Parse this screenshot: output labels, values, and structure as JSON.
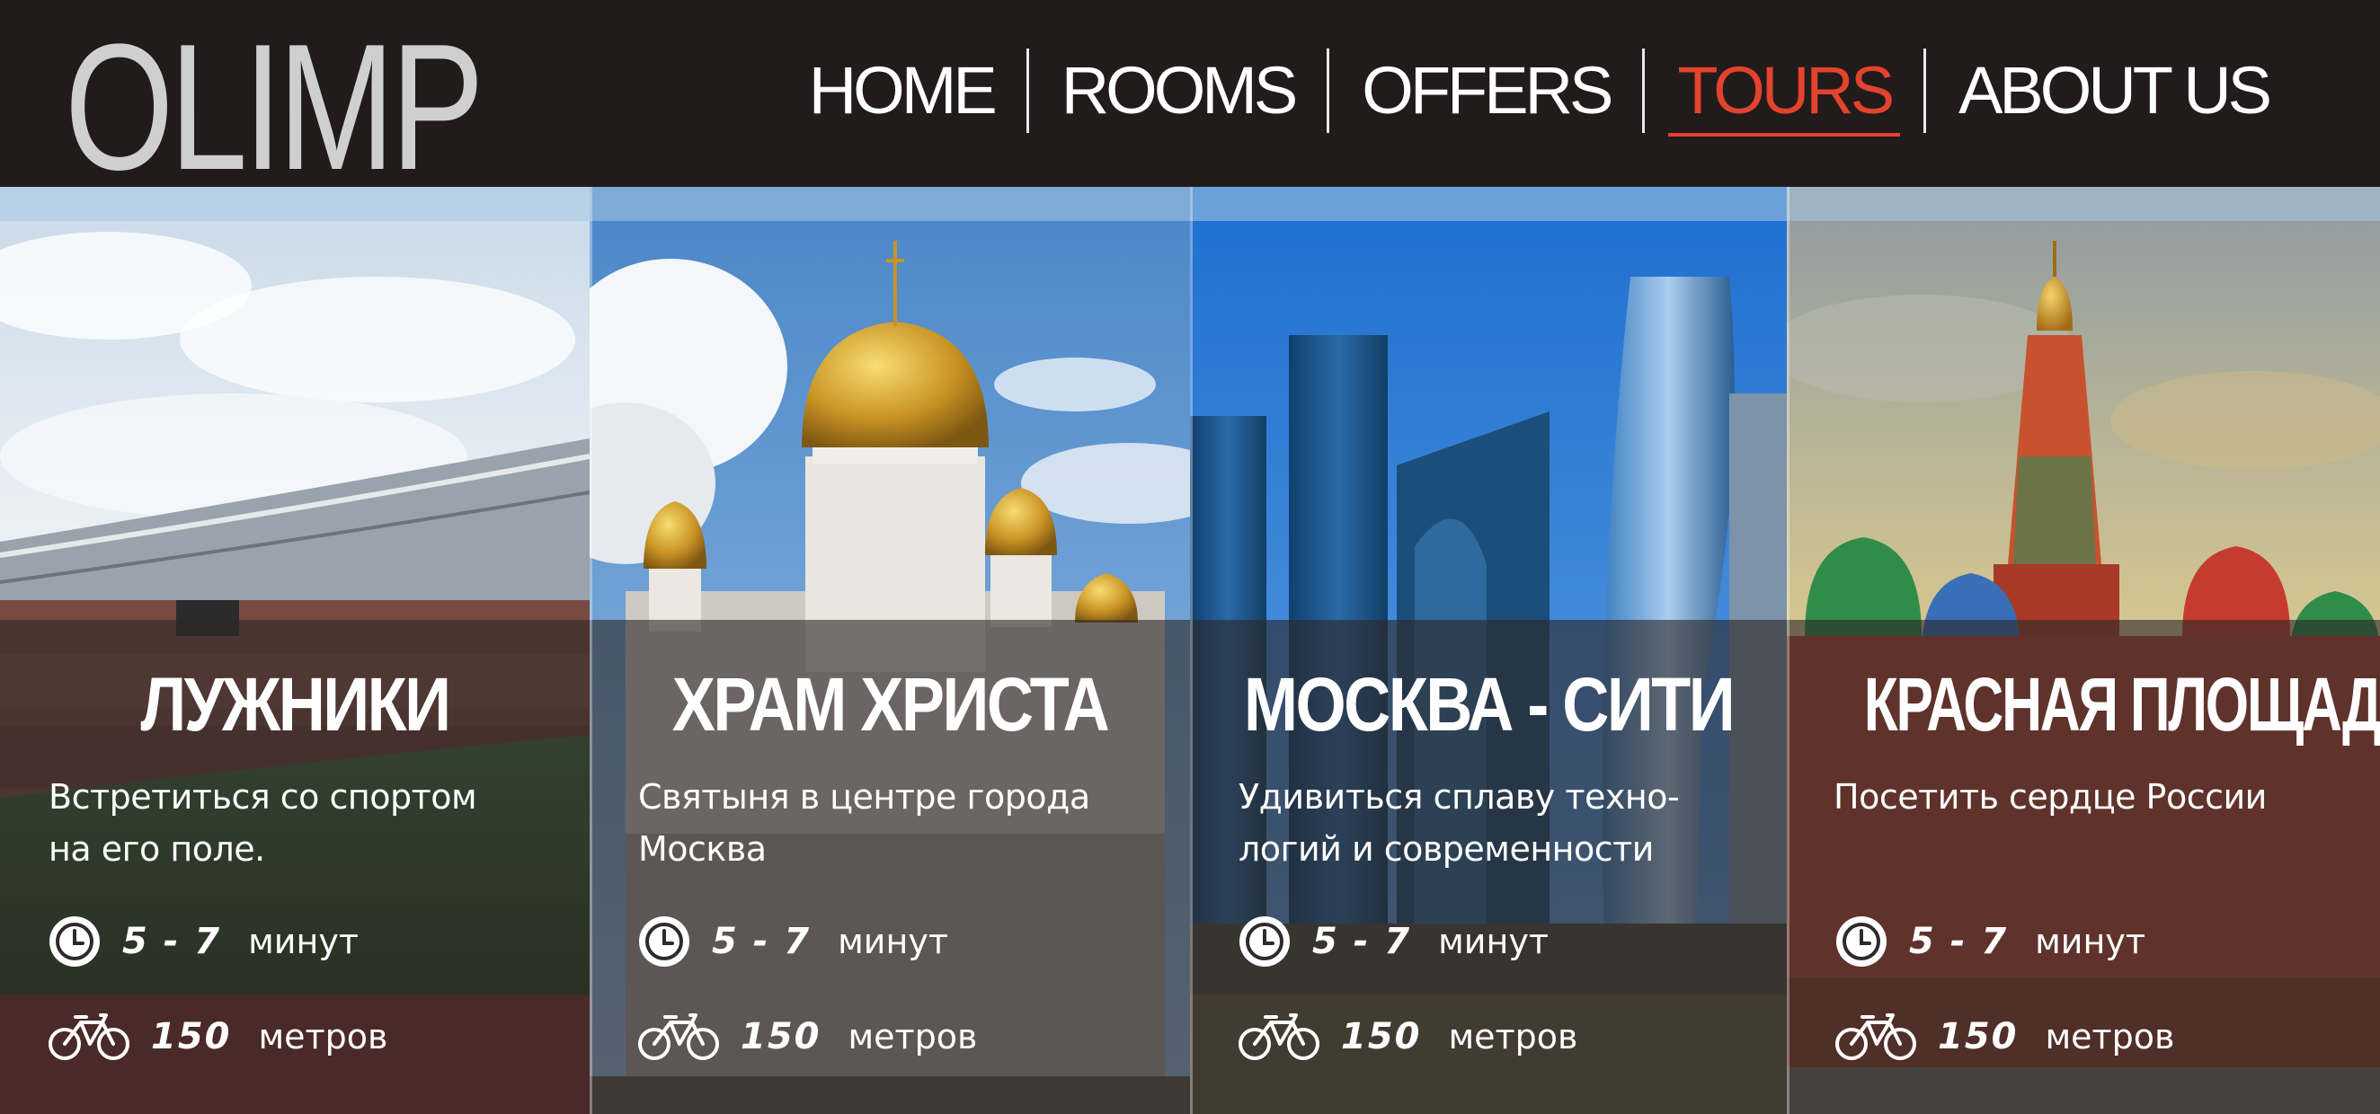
{
  "header": {
    "logo": "OLIMP",
    "nav": [
      {
        "label": "HOME",
        "active": false
      },
      {
        "label": "ROOMS",
        "active": false
      },
      {
        "label": "OFFERS",
        "active": false
      },
      {
        "label": "TOURS",
        "active": true
      },
      {
        "label": "ABOUT US",
        "active": false
      }
    ],
    "active_color": "#e3432d"
  },
  "cards": [
    {
      "title": "ЛУЖНИКИ",
      "desc_line1": "Встретиться со спортом",
      "desc_line2": "на его поле.",
      "time_value": "5 - 7",
      "time_unit": "минут",
      "distance_value": "150",
      "distance_unit": "метров",
      "photo": "stadium"
    },
    {
      "title": "ХРАМ ХРИСТА",
      "desc_line1": "Святыня в центре города",
      "desc_line2": "Москва",
      "time_value": "5 - 7",
      "time_unit": "минут",
      "distance_value": "150",
      "distance_unit": "метров",
      "photo": "cathedral"
    },
    {
      "title": "МОСКВА - СИТИ",
      "desc_line1": "Удивиться сплаву техно-",
      "desc_line2": "логий и современности",
      "time_value": "5 - 7",
      "time_unit": "минут",
      "distance_value": "150",
      "distance_unit": "метров",
      "photo": "skyscrapers"
    },
    {
      "title": "КРАСНАЯ ПЛОЩАДЬ",
      "desc_line1": "Посетить сердце России",
      "desc_line2": "",
      "time_value": "5 - 7",
      "time_unit": "минут",
      "distance_value": "150",
      "distance_unit": "метров",
      "photo": "red-square"
    }
  ],
  "icons": {
    "time": "clock-icon",
    "distance": "bicycle-icon"
  }
}
